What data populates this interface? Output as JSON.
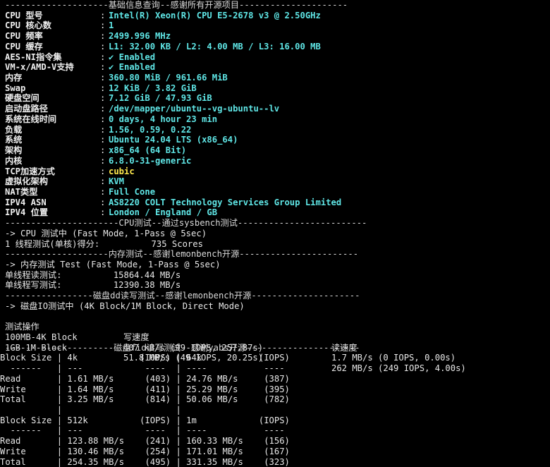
{
  "sections": {
    "basic_header": "--------------------基础信息查询--感谢所有开源项目---------------------",
    "cpu_header": "----------------------CPU测试--通过sysbench测试-------------------------",
    "mem_header": "--------------------内存测试--感谢lemonbench开源-----------------------",
    "disk_dd_header": "-----------------磁盘dd读写测试--感谢lemonbench开源---------------------",
    "disk_fio_header": "---------------------磁盘fio读写测试--感谢yabs开源----------------------"
  },
  "basic_info": [
    {
      "label": "CPU 型号",
      "value": "Intel(R) Xeon(R) CPU E5-2678 v3 @ 2.50GHz"
    },
    {
      "label": "CPU 核心数",
      "value": "1"
    },
    {
      "label": "CPU 频率",
      "value": "2499.996 MHz"
    },
    {
      "label": "CPU 缓存",
      "value": "L1: 32.00 KB / L2: 4.00 MB / L3: 16.00 MB"
    },
    {
      "label": "AES-NI指令集",
      "value": "✔ Enabled"
    },
    {
      "label": "VM-x/AMD-V支持",
      "value": "✔ Enabled"
    },
    {
      "label": "内存",
      "value": "360.80 MiB / 961.66 MiB"
    },
    {
      "label": "Swap",
      "value": "12 KiB / 3.82 GiB"
    },
    {
      "label": "硬盘空间",
      "value": "7.12 GiB / 47.93 GiB"
    },
    {
      "label": "启动盘路径",
      "value": "/dev/mapper/ubuntu--vg-ubuntu--lv"
    },
    {
      "label": "系统在线时间",
      "value": "0 days, 4 hour 23 min"
    },
    {
      "label": "负载",
      "value": "1.56, 0.59, 0.22"
    },
    {
      "label": "系统",
      "value": "Ubuntu 24.04 LTS (x86_64)"
    },
    {
      "label": "架构",
      "value": "x86_64 (64 Bit)"
    },
    {
      "label": "内核",
      "value": "6.8.0-31-generic"
    },
    {
      "label": "TCP加速方式",
      "value": "cubic"
    },
    {
      "label": "虚拟化架构",
      "value": "KVM"
    },
    {
      "label": "NAT类型",
      "value": "Full Cone"
    },
    {
      "label": "IPV4 ASN",
      "value": "AS8220 COLT Technology Services Group Limited"
    },
    {
      "label": "IPV4 位置",
      "value": "London / England / GB"
    }
  ],
  "cpu_test": {
    "line1": "-> CPU 测试中 (Fast Mode, 1-Pass @ 5sec)",
    "line2": "1 线程测试(单核)得分:          735 Scores"
  },
  "mem_test": {
    "line1": "-> 内存测试 Test (Fast Mode, 1-Pass @ 5sec)",
    "read": "单线程读测试:          15864.44 MB/s",
    "write": "单线程写测试:          12390.38 MB/s"
  },
  "dd_test": {
    "line1": "-> 磁盘IO测试中 (4K Block/1M Block, Direct Mode)",
    "headers": [
      "测试操作",
      "写速度",
      "读速度"
    ],
    "rows": [
      [
        "100MB-4K Block",
        "407 kB/s (99 IOPS, 257.87s)",
        "1.7 MB/s (0 IOPS, 0.00s)"
      ],
      [
        "1GB-1M Block",
        "51.8 MB/s (49 IOPS, 20.25s)",
        "262 MB/s (249 IOPS, 4.00s)"
      ]
    ]
  },
  "fio": {
    "lines": [
      "Block Size | 4k            (IOPS) | 64k           (IOPS)",
      "  ------   | ---            ----  | ----           ---- ",
      "Read       | 1.61 MB/s      (403) | 24.76 MB/s     (387)",
      "Write      | 1.64 MB/s      (411) | 25.29 MB/s     (395)",
      "Total      | 3.25 MB/s      (814) | 50.06 MB/s     (782)",
      "           |                      |                     ",
      "Block Size | 512k          (IOPS) | 1m            (IOPS)",
      "  ------   | ---            ----  | ----           ---- ",
      "Read       | 123.88 MB/s    (241) | 160.33 MB/s    (156)",
      "Write      | 130.46 MB/s    (254) | 171.01 MB/s    (167)",
      "Total      | 254.35 MB/s    (495) | 331.35 MB/s    (323)"
    ]
  },
  "colors": {
    "background": "#000000",
    "label": "#f0f0f0",
    "value": "#5fe6e6",
    "highlight": "#ffe94d",
    "text": "#e6e6e6"
  }
}
